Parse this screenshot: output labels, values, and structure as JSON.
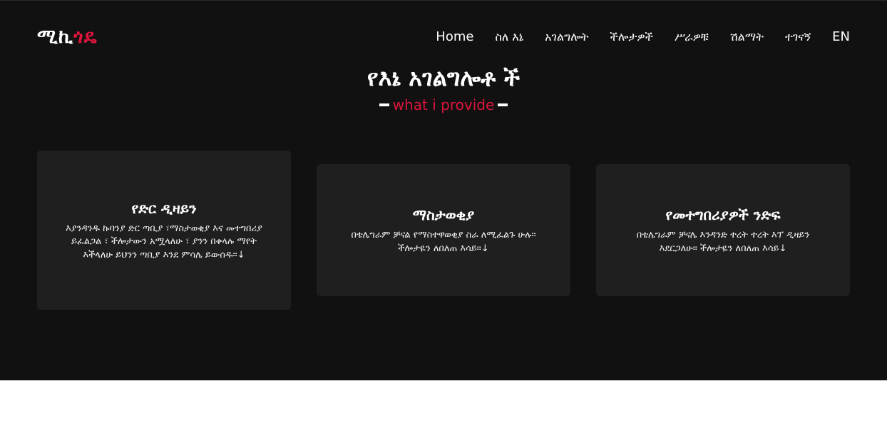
{
  "brand": {
    "logo_main": "ሚኪ",
    "logo_accent": "ጎዴ",
    "accent_color": "#dc143c",
    "background_color": "#111111",
    "card_color": "#1f1f1f"
  },
  "nav": {
    "items": [
      {
        "label": "Home"
      },
      {
        "label": "ስለ እኔ"
      },
      {
        "label": "አገልግሎት"
      },
      {
        "label": "ችሎታዎች"
      },
      {
        "label": "ሥራዎቹ"
      },
      {
        "label": "ሽልማት"
      },
      {
        "label": "ተገናኝ"
      },
      {
        "label": "EN"
      }
    ]
  },
  "services": {
    "title": "የእኔ አገልግሎቶ ች",
    "subtitle": "what i provide",
    "cards": [
      {
        "title": "የድር ዲዛይን",
        "text": "እያንዳንዱ ኩባንያ ድር ጣቢያ ፣ማስታወቂያ እና መተግበሪያ ይፈልጋል ፣ ችሎታውን አሟላለሁ ፣ ያንን በቀላሉ ማየት እችላለሁ ይህንን ጣቢያ እንደ ምሳሌ ይውሰዱ።↓"
      },
      {
        "title": "ማስታወቂያ",
        "text": "በቴሌግራም ቻናል የማስተዋወቂያ ስራ ለሚፈልጉ ሁሉ። ችሎታዬን ለበለጠ እሳይ።↓"
      },
      {
        "title": "የመተግበሪያዎች ንድፍ",
        "text": "በቴሌግራም ቻናሌ እንዳንድ ተረት ተረት እፕ ዲዛይን እደርጋለሁ። ችሎታዬን ለበለጠ እሳይ↓"
      }
    ]
  }
}
